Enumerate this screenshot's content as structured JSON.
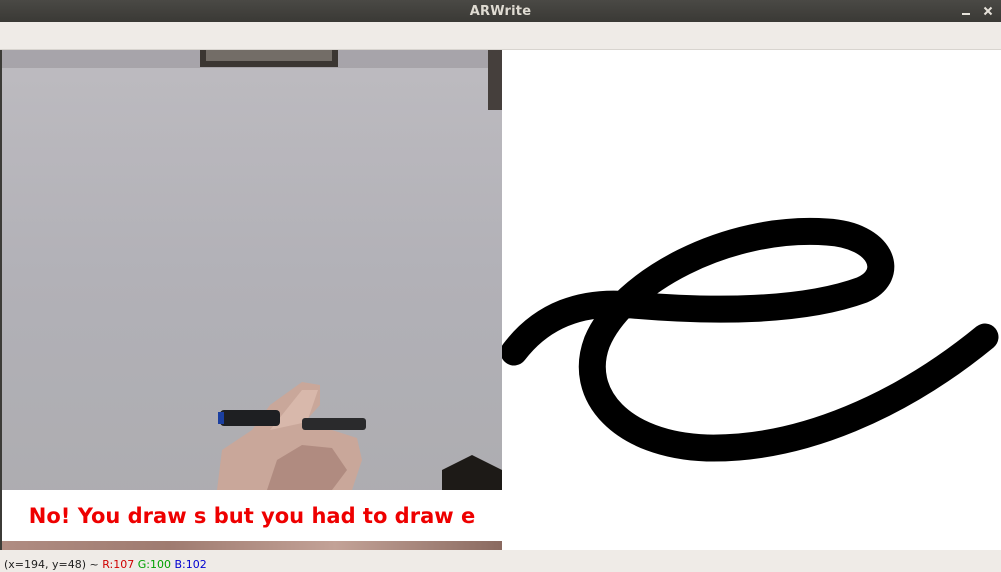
{
  "window": {
    "title": "ARWrite"
  },
  "feedback": {
    "message": "No! You draw s but you had to draw e"
  },
  "canvas": {
    "letter": "e"
  },
  "status": {
    "coords": "(x=194, y=48) ~",
    "r": "R:107",
    "g": "G:100",
    "b": "B:102"
  },
  "icons": {
    "minimize": "minimize-icon",
    "close": "close-icon"
  },
  "colors": {
    "feedback_text": "#ee0000",
    "stroke": "#000000"
  }
}
